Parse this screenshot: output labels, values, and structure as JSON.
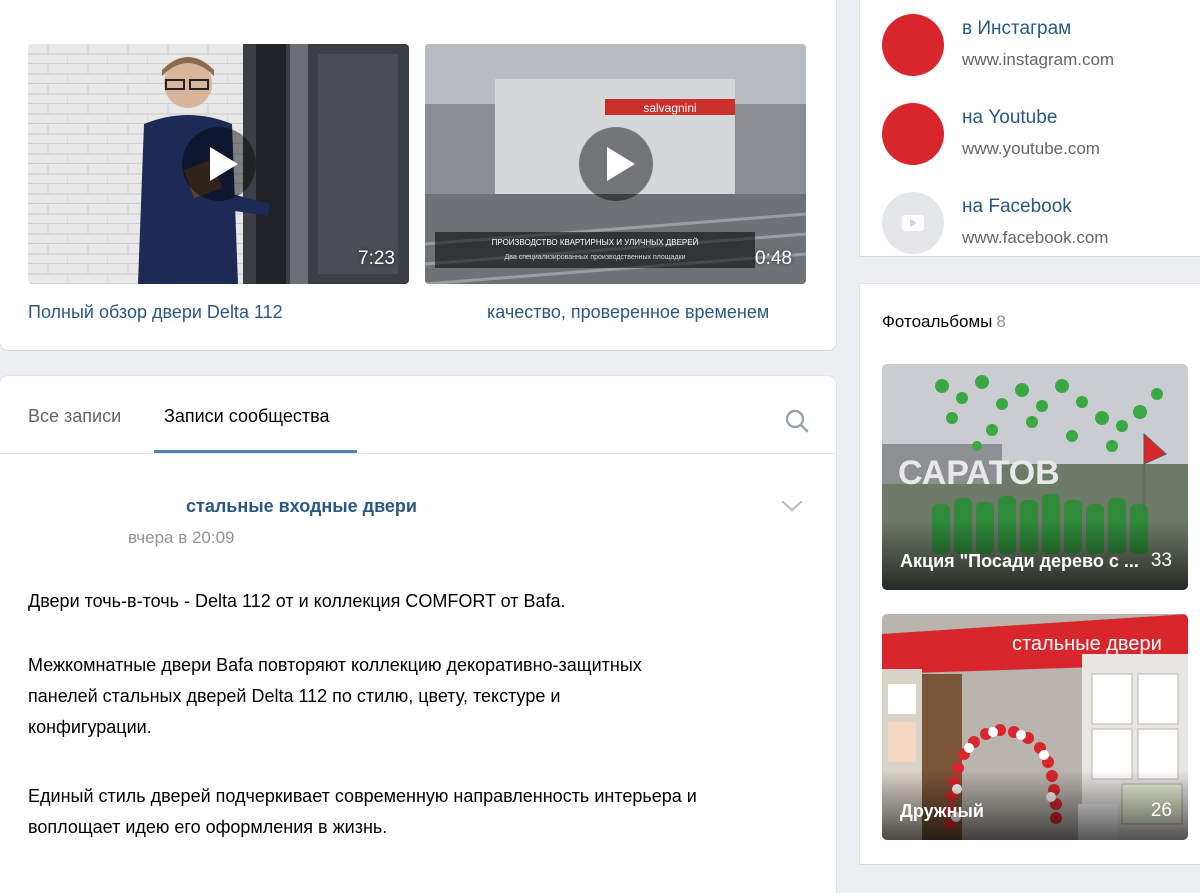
{
  "videos": [
    {
      "title": "Полный обзор двери Delta 112",
      "duration": "7:23",
      "icon": "play-icon"
    },
    {
      "title": "качество, проверенное временем",
      "duration": "0:48",
      "icon": "play-icon",
      "overlay_brand": "salvagnini",
      "overlay_caption_1": "ПРОИЗВОДСТВО КВАРТИРНЫХ И УЛИЧНЫХ ДВЕРЕЙ",
      "overlay_caption_2": "Два специализированных производственных площадки"
    }
  ],
  "wall": {
    "tabs": [
      {
        "label": "Все записи"
      },
      {
        "label": "Записи сообщества"
      }
    ],
    "search_icon": "search-icon",
    "post": {
      "author": "стальные входные двери",
      "time": "вчера в 20:09",
      "lines": [
        "Двери точь-в-точь - Delta 112 от         и коллекция COMFORT от Bafa.",
        "Межкомнатные двери Bafa повторяют коллекцию декоративно-защитных",
        "панелей стальных дверей         Delta 112 по стилю, цвету, текстуре и",
        "конфигурации.",
        "Единый стиль дверей подчеркивает современную направленность интерьера и",
        "воплощает идею его оформления в жизнь."
      ]
    }
  },
  "links": [
    {
      "title": "в Инстаграм",
      "url": "www.instagram.com"
    },
    {
      "title": "на Youtube",
      "url": "www.youtube.com"
    },
    {
      "title": "на Facebook",
      "url": "www.facebook.com"
    }
  ],
  "albums": {
    "heading": "Фотоальбомы",
    "count": "8",
    "items": [
      {
        "title": "Акция \"Посади дерево с ...",
        "count": "33",
        "sign_text": "САРАТОВ"
      },
      {
        "title": "Дружный",
        "count": "26",
        "banner_text": "стальные двери"
      }
    ]
  },
  "colors": {
    "link": "#2a5885",
    "accent": "#5181b8",
    "brand_red": "#d9262d"
  }
}
